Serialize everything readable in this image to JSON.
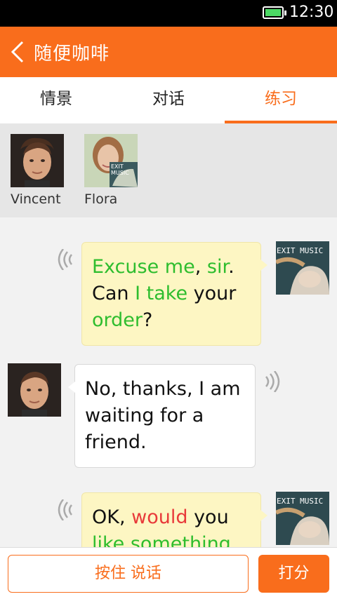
{
  "status_bar": {
    "time": "12:30",
    "battery_icon": "battery-charging-icon"
  },
  "header": {
    "title": "随便咖啡",
    "back_icon": "back-arrow-icon"
  },
  "tabs": [
    {
      "label": "情景",
      "active": false
    },
    {
      "label": "对话",
      "active": false
    },
    {
      "label": "练习",
      "active": true
    }
  ],
  "roles": [
    {
      "name": "Vincent"
    },
    {
      "name": "Flora"
    }
  ],
  "messages": [
    {
      "side": "right",
      "speaker": "Flora",
      "segments": [
        {
          "text": "Excuse me",
          "style": "green"
        },
        {
          "text": ", ",
          "style": "normal"
        },
        {
          "text": "sir",
          "style": "green"
        },
        {
          "text": ". Can ",
          "style": "normal"
        },
        {
          "text": "I take",
          "style": "green"
        },
        {
          "text": " your ",
          "style": "normal"
        },
        {
          "text": "order",
          "style": "green"
        },
        {
          "text": "?",
          "style": "normal"
        }
      ]
    },
    {
      "side": "left",
      "speaker": "Vincent",
      "segments": [
        {
          "text": "No, thanks, I am waiting for a friend.",
          "style": "normal"
        }
      ]
    },
    {
      "side": "right",
      "speaker": "Flora",
      "segments": [
        {
          "text": "OK, ",
          "style": "normal"
        },
        {
          "text": "would",
          "style": "red"
        },
        {
          "text": " you ",
          "style": "normal"
        },
        {
          "text": "like something",
          "style": "green"
        }
      ]
    }
  ],
  "bottom": {
    "hold_to_talk": "按住 说话",
    "score": "打分"
  },
  "colors": {
    "accent": "#f96d1c",
    "green_word": "#2ebd2e",
    "red_word": "#e83a3a"
  },
  "avatar_overlay_text": "EXIT MUSIC"
}
